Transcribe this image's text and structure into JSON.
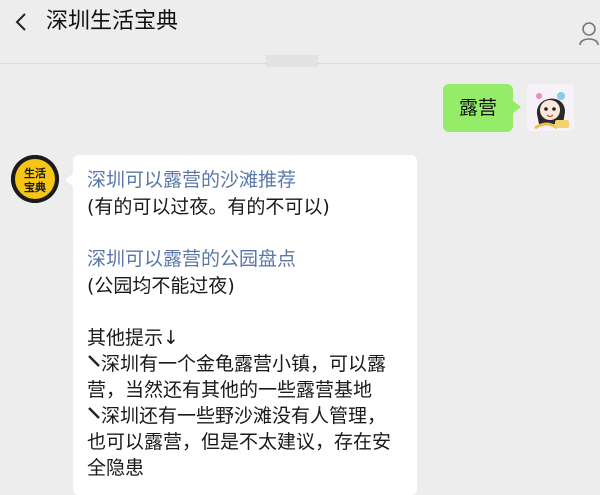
{
  "header": {
    "title": "深圳生活宝典",
    "back_icon": "chevron-left-icon",
    "profile_icon": "person-icon"
  },
  "outgoing": {
    "text": "露营"
  },
  "incoming": {
    "avatar_text_top": "生活",
    "avatar_text_bottom": "宝典",
    "link1": "深圳可以露营的沙滩推荐",
    "note1": "(有的可以过夜。有的不可以)",
    "link2": "深圳可以露营的公园盘点",
    "note2": " (公园均不能过夜)",
    "tips_heading": "其他提示↓",
    "tip1_line1": "深圳有一个金龟露营小镇，可以露",
    "tip1_line2": "营，当然还有其他的一些露营基地",
    "tip2_line1": "深圳还有一些野沙滩没有人管理，",
    "tip2_line2": "也可以露营，但是不太建议，存在安",
    "tip2_line3": "全隐患"
  },
  "colors": {
    "background": "#ededed",
    "outgoing_bubble": "#95ec69",
    "incoming_bubble": "#ffffff",
    "link": "#5a77a8",
    "bot_avatar_bg": "#1b1b1b",
    "bot_avatar_accent": "#f5c518"
  }
}
